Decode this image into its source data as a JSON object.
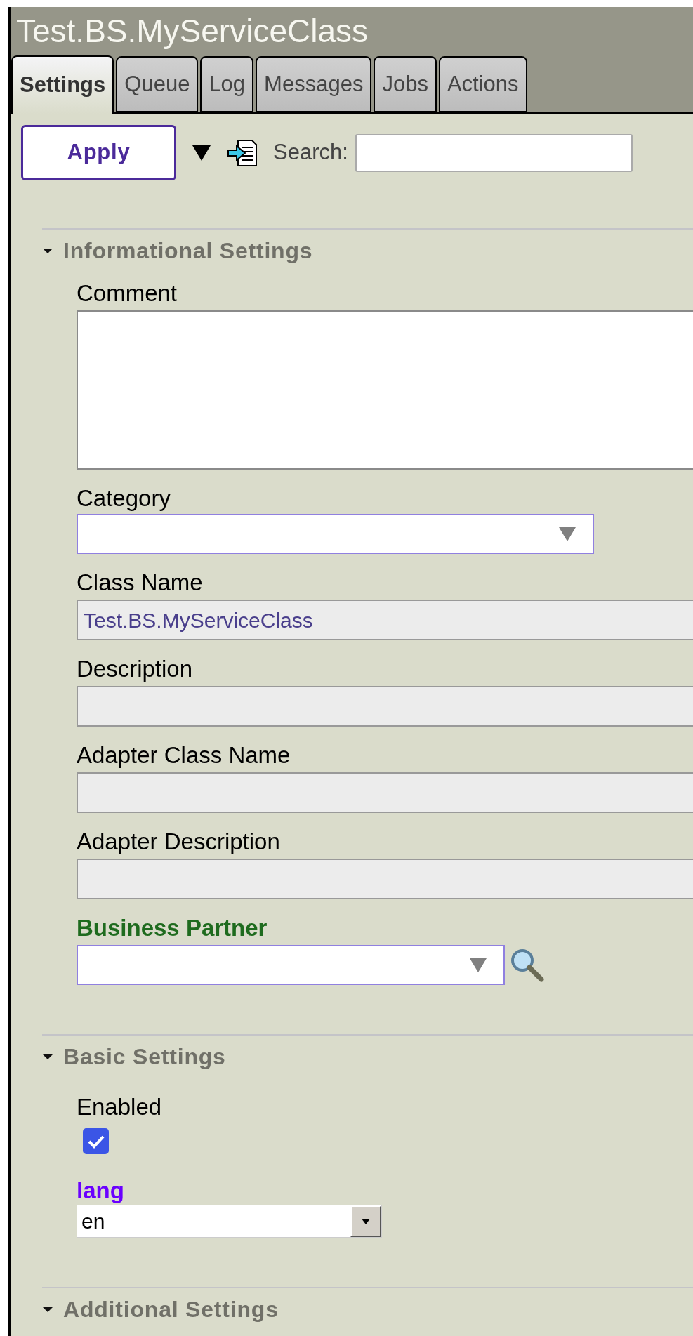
{
  "title": "Test.BS.MyServiceClass",
  "tabs": [
    {
      "label": "Settings",
      "selected": true
    },
    {
      "label": "Queue",
      "selected": false
    },
    {
      "label": "Log",
      "selected": false
    },
    {
      "label": "Messages",
      "selected": false
    },
    {
      "label": "Jobs",
      "selected": false
    },
    {
      "label": "Actions",
      "selected": false
    }
  ],
  "toolbar": {
    "apply": "Apply",
    "search_label": "Search:"
  },
  "sections": [
    {
      "title": "Informational Settings",
      "expanded": true,
      "fields": [
        {
          "kind": "textarea",
          "label": "Comment"
        },
        {
          "kind": "select",
          "label": "Category"
        },
        {
          "kind": "readonly",
          "label": "Class Name",
          "value": "Test.BS.MyServiceClass"
        },
        {
          "kind": "readonly",
          "label": "Description"
        },
        {
          "kind": "readonly",
          "label": "Adapter Class Name"
        },
        {
          "kind": "readonly",
          "label": "Adapter Description"
        },
        {
          "kind": "lookup",
          "label": "Business Partner",
          "color": "#1e6b1e"
        }
      ]
    },
    {
      "title": "Basic Settings",
      "expanded": true,
      "fields": [
        {
          "kind": "checkbox",
          "label": "Enabled",
          "checked": true
        },
        {
          "kind": "combo",
          "label": "lang",
          "color": "#6a00ff",
          "value": "en"
        }
      ]
    },
    {
      "title": "Additional Settings",
      "expanded": true
    }
  ]
}
